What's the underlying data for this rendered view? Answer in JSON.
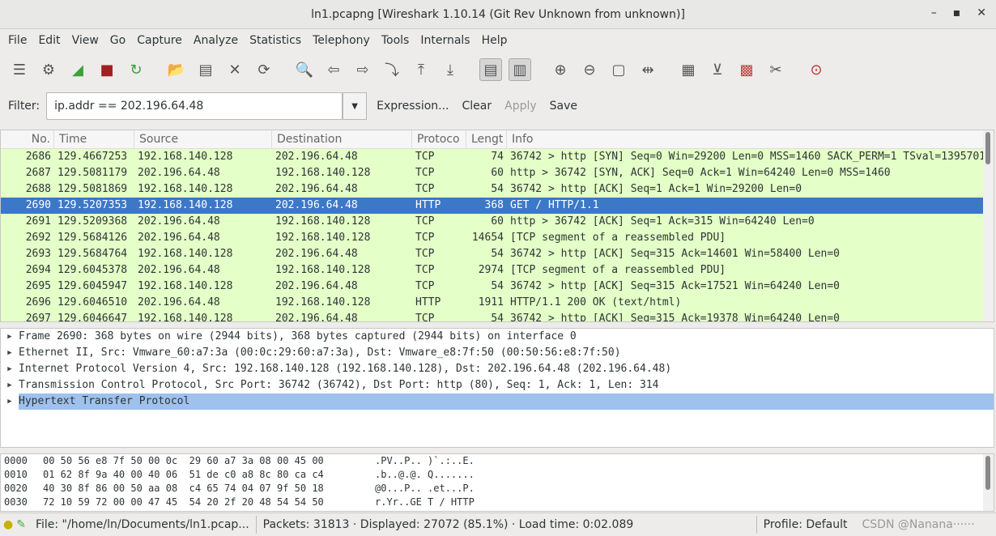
{
  "window": {
    "title": "ln1.pcapng  [Wireshark 1.10.14  (Git Rev Unknown from unknown)]",
    "min": "–",
    "max": "▪",
    "close": "✕"
  },
  "menu": [
    "File",
    "Edit",
    "View",
    "Go",
    "Capture",
    "Analyze",
    "Statistics",
    "Telephony",
    "Tools",
    "Internals",
    "Help"
  ],
  "toolbar": [
    {
      "name": "interfaces-icon",
      "g": "☰"
    },
    {
      "name": "options-icon",
      "g": "⚙"
    },
    {
      "name": "start-capture-icon",
      "g": "◢",
      "c": "#3aa33a"
    },
    {
      "name": "stop-capture-icon",
      "g": "■",
      "c": "#a02020"
    },
    {
      "name": "restart-capture-icon",
      "g": "↻",
      "c": "#3aa33a"
    },
    {
      "sep": true
    },
    {
      "name": "open-file-icon",
      "g": "📂"
    },
    {
      "name": "save-file-icon",
      "g": "▤"
    },
    {
      "name": "close-file-icon",
      "g": "✕"
    },
    {
      "name": "reload-icon",
      "g": "⟳"
    },
    {
      "sep": true
    },
    {
      "name": "find-packet-icon",
      "g": "🔍",
      "c": "#1f4f9a"
    },
    {
      "name": "go-back-icon",
      "g": "⇦"
    },
    {
      "name": "go-forward-icon",
      "g": "⇨"
    },
    {
      "name": "go-to-packet-icon",
      "g": "⤵"
    },
    {
      "name": "first-packet-icon",
      "g": "⤒"
    },
    {
      "name": "last-packet-icon",
      "g": "⤓"
    },
    {
      "sep": true
    },
    {
      "name": "colorize-icon",
      "g": "▤",
      "p": true
    },
    {
      "name": "auto-scroll-icon",
      "g": "▥",
      "p": true
    },
    {
      "sep": true
    },
    {
      "name": "zoom-in-icon",
      "g": "⊕"
    },
    {
      "name": "zoom-out-icon",
      "g": "⊖"
    },
    {
      "name": "normal-size-icon",
      "g": "▢"
    },
    {
      "name": "resize-columns-icon",
      "g": "⇹"
    },
    {
      "sep": true
    },
    {
      "name": "capture-filters-icon",
      "g": "▦"
    },
    {
      "name": "display-filters-icon",
      "g": "⊻"
    },
    {
      "name": "coloring-rules-icon",
      "g": "▩",
      "c": "#c04040"
    },
    {
      "name": "preferences-icon",
      "g": "✂"
    },
    {
      "sep": true
    },
    {
      "name": "help-icon",
      "g": "⊙",
      "c": "#c03030"
    }
  ],
  "filter": {
    "label": "Filter:",
    "value": "ip.addr == 202.196.64.48",
    "expression": "Expression...",
    "clear": "Clear",
    "apply": "Apply",
    "save": "Save"
  },
  "packet_list": {
    "columns": [
      "No.",
      "Time",
      "Source",
      "Destination",
      "Protocol",
      "Length",
      "Info"
    ],
    "column_display": [
      "No.",
      "Time",
      "Source",
      "Destination",
      "Protoco",
      "Lengt",
      "Info"
    ],
    "selected_index": 3,
    "rows": [
      [
        "2686",
        "129.4667253",
        "192.168.140.128",
        "202.196.64.48",
        "TCP",
        "74",
        "36742 > http [SYN] Seq=0 Win=29200 Len=0 MSS=1460 SACK_PERM=1 TSval=1395701"
      ],
      [
        "2687",
        "129.5081179",
        "202.196.64.48",
        "192.168.140.128",
        "TCP",
        "60",
        "http > 36742 [SYN, ACK] Seq=0 Ack=1 Win=64240 Len=0 MSS=1460"
      ],
      [
        "2688",
        "129.5081869",
        "192.168.140.128",
        "202.196.64.48",
        "TCP",
        "54",
        "36742 > http [ACK] Seq=1 Ack=1 Win=29200 Len=0"
      ],
      [
        "2690",
        "129.5207353",
        "192.168.140.128",
        "202.196.64.48",
        "HTTP",
        "368",
        "GET / HTTP/1.1"
      ],
      [
        "2691",
        "129.5209368",
        "202.196.64.48",
        "192.168.140.128",
        "TCP",
        "60",
        "http > 36742 [ACK] Seq=1 Ack=315 Win=64240 Len=0"
      ],
      [
        "2692",
        "129.5684126",
        "202.196.64.48",
        "192.168.140.128",
        "TCP",
        "14654",
        "[TCP segment of a reassembled PDU]"
      ],
      [
        "2693",
        "129.5684764",
        "192.168.140.128",
        "202.196.64.48",
        "TCP",
        "54",
        "36742 > http [ACK] Seq=315 Ack=14601 Win=58400 Len=0"
      ],
      [
        "2694",
        "129.6045378",
        "202.196.64.48",
        "192.168.140.128",
        "TCP",
        "2974",
        "[TCP segment of a reassembled PDU]"
      ],
      [
        "2695",
        "129.6045947",
        "192.168.140.128",
        "202.196.64.48",
        "TCP",
        "54",
        "36742 > http [ACK] Seq=315 Ack=17521 Win=64240 Len=0"
      ],
      [
        "2696",
        "129.6046510",
        "202.196.64.48",
        "192.168.140.128",
        "HTTP",
        "1911",
        "HTTP/1.1 200 OK  (text/html)"
      ],
      [
        "2697",
        "129.6046647",
        "192.168.140.128",
        "202.196.64.48",
        "TCP",
        "54",
        "36742 > http [ACK] Seq=315 Ack=19378 Win=64240 Len=0"
      ]
    ]
  },
  "details": [
    "Frame 2690: 368 bytes on wire (2944 bits), 368 bytes captured (2944 bits) on interface 0",
    "Ethernet II, Src: Vmware_60:a7:3a (00:0c:29:60:a7:3a), Dst: Vmware_e8:7f:50 (00:50:56:e8:7f:50)",
    "Internet Protocol Version 4, Src: 192.168.140.128 (192.168.140.128), Dst: 202.196.64.48 (202.196.64.48)",
    "Transmission Control Protocol, Src Port: 36742 (36742), Dst Port: http (80), Seq: 1, Ack: 1, Len: 314",
    "Hypertext Transfer Protocol"
  ],
  "hex": [
    [
      "0000",
      "00 50 56 e8 7f 50 00 0c  29 60 a7 3a 08 00 45 00",
      ".PV..P.. )`.:..E."
    ],
    [
      "0010",
      "01 62 8f 9a 40 00 40 06  51 de c0 a8 8c 80 ca c4",
      ".b..@.@. Q......."
    ],
    [
      "0020",
      "40 30 8f 86 00 50 aa 08  c4 65 74 04 07 9f 50 18",
      "@0...P.. .et...P."
    ],
    [
      "0030",
      "72 10 59 72 00 00 47 45  54 20 2f 20 48 54 54 50",
      "r.Yr..GE T / HTTP"
    ]
  ],
  "status": {
    "file": "File: \"/home/ln/Documents/ln1.pcap...",
    "packets": "Packets: 31813 · Displayed: 27072 (85.1%) · Load time: 0:02.089",
    "profile": "Profile: Default",
    "watermark": "CSDN @Nanana······"
  },
  "colors": {
    "tcp_row": "#e4ffc7",
    "selected": "#3c78c8",
    "detail_selected": "#9ec1ed"
  }
}
